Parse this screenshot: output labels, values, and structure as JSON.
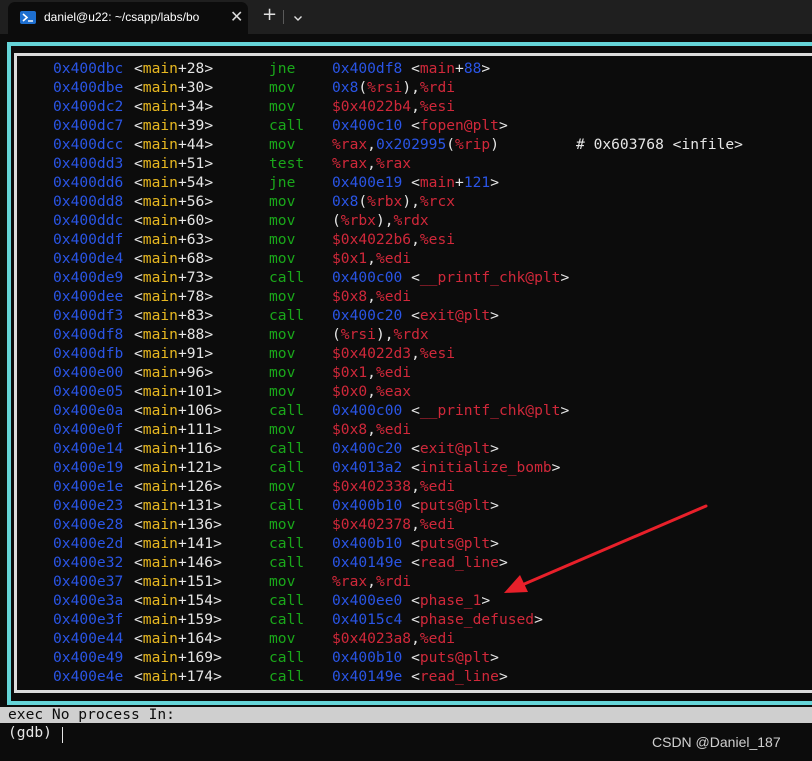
{
  "window": {
    "tab_title": "daniel@u22: ~/csapp/labs/bo",
    "close_glyph": "✕",
    "new_tab_glyph": "+"
  },
  "disassembly": [
    {
      "addr": "0x400dbc",
      "fn": "main",
      "off": "+28",
      "mnemonic": "jne",
      "operands": [
        {
          "t": "0x400df8 ",
          "c": "num"
        },
        {
          "t": "<",
          "c": "w"
        },
        {
          "t": "main",
          "c": "sym"
        },
        {
          "t": "+",
          "c": "w"
        },
        {
          "t": "88",
          "c": "num"
        },
        {
          "t": ">",
          "c": "w"
        }
      ]
    },
    {
      "addr": "0x400dbe",
      "fn": "main",
      "off": "+30",
      "mnemonic": "mov",
      "operands": [
        {
          "t": "0x8",
          "c": "num"
        },
        {
          "t": "(",
          "c": "w"
        },
        {
          "t": "%rsi",
          "c": "reg"
        },
        {
          "t": "),",
          "c": "w"
        },
        {
          "t": "%rdi",
          "c": "reg"
        }
      ]
    },
    {
      "addr": "0x400dc2",
      "fn": "main",
      "off": "+34",
      "mnemonic": "mov",
      "operands": [
        {
          "t": "$0x4022b4",
          "c": "reg"
        },
        {
          "t": ",",
          "c": "w"
        },
        {
          "t": "%esi",
          "c": "reg"
        }
      ]
    },
    {
      "addr": "0x400dc7",
      "fn": "main",
      "off": "+39",
      "mnemonic": "call",
      "operands": [
        {
          "t": "0x400c10 ",
          "c": "num"
        },
        {
          "t": "<",
          "c": "w"
        },
        {
          "t": "fopen@plt",
          "c": "sym"
        },
        {
          "t": ">",
          "c": "w"
        }
      ]
    },
    {
      "addr": "0x400dcc",
      "fn": "main",
      "off": "+44",
      "mnemonic": "mov",
      "operands": [
        {
          "t": "%rax",
          "c": "reg"
        },
        {
          "t": ",",
          "c": "w"
        },
        {
          "t": "0x202995",
          "c": "num"
        },
        {
          "t": "(",
          "c": "w"
        },
        {
          "t": "%rip",
          "c": "reg"
        },
        {
          "t": ")",
          "c": "w"
        }
      ],
      "comment": "# 0x603768 <infile>"
    },
    {
      "addr": "0x400dd3",
      "fn": "main",
      "off": "+51",
      "mnemonic": "test",
      "operands": [
        {
          "t": "%rax",
          "c": "reg"
        },
        {
          "t": ",",
          "c": "w"
        },
        {
          "t": "%rax",
          "c": "reg"
        }
      ]
    },
    {
      "addr": "0x400dd6",
      "fn": "main",
      "off": "+54",
      "mnemonic": "jne",
      "operands": [
        {
          "t": "0x400e19 ",
          "c": "num"
        },
        {
          "t": "<",
          "c": "w"
        },
        {
          "t": "main",
          "c": "sym"
        },
        {
          "t": "+",
          "c": "w"
        },
        {
          "t": "121",
          "c": "num"
        },
        {
          "t": ">",
          "c": "w"
        }
      ]
    },
    {
      "addr": "0x400dd8",
      "fn": "main",
      "off": "+56",
      "mnemonic": "mov",
      "operands": [
        {
          "t": "0x8",
          "c": "num"
        },
        {
          "t": "(",
          "c": "w"
        },
        {
          "t": "%rbx",
          "c": "reg"
        },
        {
          "t": "),",
          "c": "w"
        },
        {
          "t": "%rcx",
          "c": "reg"
        }
      ]
    },
    {
      "addr": "0x400ddc",
      "fn": "main",
      "off": "+60",
      "mnemonic": "mov",
      "operands": [
        {
          "t": "(",
          "c": "w"
        },
        {
          "t": "%rbx",
          "c": "reg"
        },
        {
          "t": "),",
          "c": "w"
        },
        {
          "t": "%rdx",
          "c": "reg"
        }
      ]
    },
    {
      "addr": "0x400ddf",
      "fn": "main",
      "off": "+63",
      "mnemonic": "mov",
      "operands": [
        {
          "t": "$0x4022b6",
          "c": "reg"
        },
        {
          "t": ",",
          "c": "w"
        },
        {
          "t": "%esi",
          "c": "reg"
        }
      ]
    },
    {
      "addr": "0x400de4",
      "fn": "main",
      "off": "+68",
      "mnemonic": "mov",
      "operands": [
        {
          "t": "$0x1",
          "c": "reg"
        },
        {
          "t": ",",
          "c": "w"
        },
        {
          "t": "%edi",
          "c": "reg"
        }
      ]
    },
    {
      "addr": "0x400de9",
      "fn": "main",
      "off": "+73",
      "mnemonic": "call",
      "operands": [
        {
          "t": "0x400c00 ",
          "c": "num"
        },
        {
          "t": "<",
          "c": "w"
        },
        {
          "t": "__printf_chk@plt",
          "c": "sym"
        },
        {
          "t": ">",
          "c": "w"
        }
      ]
    },
    {
      "addr": "0x400dee",
      "fn": "main",
      "off": "+78",
      "mnemonic": "mov",
      "operands": [
        {
          "t": "$0x8",
          "c": "reg"
        },
        {
          "t": ",",
          "c": "w"
        },
        {
          "t": "%edi",
          "c": "reg"
        }
      ]
    },
    {
      "addr": "0x400df3",
      "fn": "main",
      "off": "+83",
      "mnemonic": "call",
      "operands": [
        {
          "t": "0x400c20 ",
          "c": "num"
        },
        {
          "t": "<",
          "c": "w"
        },
        {
          "t": "exit@plt",
          "c": "sym"
        },
        {
          "t": ">",
          "c": "w"
        }
      ]
    },
    {
      "addr": "0x400df8",
      "fn": "main",
      "off": "+88",
      "mnemonic": "mov",
      "operands": [
        {
          "t": "(",
          "c": "w"
        },
        {
          "t": "%rsi",
          "c": "reg"
        },
        {
          "t": "),",
          "c": "w"
        },
        {
          "t": "%rdx",
          "c": "reg"
        }
      ]
    },
    {
      "addr": "0x400dfb",
      "fn": "main",
      "off": "+91",
      "mnemonic": "mov",
      "operands": [
        {
          "t": "$0x4022d3",
          "c": "reg"
        },
        {
          "t": ",",
          "c": "w"
        },
        {
          "t": "%esi",
          "c": "reg"
        }
      ]
    },
    {
      "addr": "0x400e00",
      "fn": "main",
      "off": "+96",
      "mnemonic": "mov",
      "operands": [
        {
          "t": "$0x1",
          "c": "reg"
        },
        {
          "t": ",",
          "c": "w"
        },
        {
          "t": "%edi",
          "c": "reg"
        }
      ]
    },
    {
      "addr": "0x400e05",
      "fn": "main",
      "off": "+101",
      "mnemonic": "mov",
      "operands": [
        {
          "t": "$0x0",
          "c": "reg"
        },
        {
          "t": ",",
          "c": "w"
        },
        {
          "t": "%eax",
          "c": "reg"
        }
      ]
    },
    {
      "addr": "0x400e0a",
      "fn": "main",
      "off": "+106",
      "mnemonic": "call",
      "operands": [
        {
          "t": "0x400c00 ",
          "c": "num"
        },
        {
          "t": "<",
          "c": "w"
        },
        {
          "t": "__printf_chk@plt",
          "c": "sym"
        },
        {
          "t": ">",
          "c": "w"
        }
      ]
    },
    {
      "addr": "0x400e0f",
      "fn": "main",
      "off": "+111",
      "mnemonic": "mov",
      "operands": [
        {
          "t": "$0x8",
          "c": "reg"
        },
        {
          "t": ",",
          "c": "w"
        },
        {
          "t": "%edi",
          "c": "reg"
        }
      ]
    },
    {
      "addr": "0x400e14",
      "fn": "main",
      "off": "+116",
      "mnemonic": "call",
      "operands": [
        {
          "t": "0x400c20 ",
          "c": "num"
        },
        {
          "t": "<",
          "c": "w"
        },
        {
          "t": "exit@plt",
          "c": "sym"
        },
        {
          "t": ">",
          "c": "w"
        }
      ]
    },
    {
      "addr": "0x400e19",
      "fn": "main",
      "off": "+121",
      "mnemonic": "call",
      "operands": [
        {
          "t": "0x4013a2 ",
          "c": "num"
        },
        {
          "t": "<",
          "c": "w"
        },
        {
          "t": "initialize_bomb",
          "c": "sym"
        },
        {
          "t": ">",
          "c": "w"
        }
      ]
    },
    {
      "addr": "0x400e1e",
      "fn": "main",
      "off": "+126",
      "mnemonic": "mov",
      "operands": [
        {
          "t": "$0x402338",
          "c": "reg"
        },
        {
          "t": ",",
          "c": "w"
        },
        {
          "t": "%edi",
          "c": "reg"
        }
      ]
    },
    {
      "addr": "0x400e23",
      "fn": "main",
      "off": "+131",
      "mnemonic": "call",
      "operands": [
        {
          "t": "0x400b10 ",
          "c": "num"
        },
        {
          "t": "<",
          "c": "w"
        },
        {
          "t": "puts@plt",
          "c": "sym"
        },
        {
          "t": ">",
          "c": "w"
        }
      ]
    },
    {
      "addr": "0x400e28",
      "fn": "main",
      "off": "+136",
      "mnemonic": "mov",
      "operands": [
        {
          "t": "$0x402378",
          "c": "reg"
        },
        {
          "t": ",",
          "c": "w"
        },
        {
          "t": "%edi",
          "c": "reg"
        }
      ]
    },
    {
      "addr": "0x400e2d",
      "fn": "main",
      "off": "+141",
      "mnemonic": "call",
      "operands": [
        {
          "t": "0x400b10 ",
          "c": "num"
        },
        {
          "t": "<",
          "c": "w"
        },
        {
          "t": "puts@plt",
          "c": "sym"
        },
        {
          "t": ">",
          "c": "w"
        }
      ]
    },
    {
      "addr": "0x400e32",
      "fn": "main",
      "off": "+146",
      "mnemonic": "call",
      "operands": [
        {
          "t": "0x40149e ",
          "c": "num"
        },
        {
          "t": "<",
          "c": "w"
        },
        {
          "t": "read_line",
          "c": "sym"
        },
        {
          "t": ">",
          "c": "w"
        }
      ]
    },
    {
      "addr": "0x400e37",
      "fn": "main",
      "off": "+151",
      "mnemonic": "mov",
      "operands": [
        {
          "t": "%rax",
          "c": "reg"
        },
        {
          "t": ",",
          "c": "w"
        },
        {
          "t": "%rdi",
          "c": "reg"
        }
      ]
    },
    {
      "addr": "0x400e3a",
      "fn": "main",
      "off": "+154",
      "mnemonic": "call",
      "operands": [
        {
          "t": "0x400ee0 ",
          "c": "num"
        },
        {
          "t": "<",
          "c": "w"
        },
        {
          "t": "phase_1",
          "c": "sym"
        },
        {
          "t": ">",
          "c": "w"
        }
      ]
    },
    {
      "addr": "0x400e3f",
      "fn": "main",
      "off": "+159",
      "mnemonic": "call",
      "operands": [
        {
          "t": "0x4015c4 ",
          "c": "num"
        },
        {
          "t": "<",
          "c": "w"
        },
        {
          "t": "phase_defused",
          "c": "sym"
        },
        {
          "t": ">",
          "c": "w"
        }
      ]
    },
    {
      "addr": "0x400e44",
      "fn": "main",
      "off": "+164",
      "mnemonic": "mov",
      "operands": [
        {
          "t": "$0x4023a8",
          "c": "reg"
        },
        {
          "t": ",",
          "c": "w"
        },
        {
          "t": "%edi",
          "c": "reg"
        }
      ]
    },
    {
      "addr": "0x400e49",
      "fn": "main",
      "off": "+169",
      "mnemonic": "call",
      "operands": [
        {
          "t": "0x400b10 ",
          "c": "num"
        },
        {
          "t": "<",
          "c": "w"
        },
        {
          "t": "puts@plt",
          "c": "sym"
        },
        {
          "t": ">",
          "c": "w"
        }
      ]
    },
    {
      "addr": "0x400e4e",
      "fn": "main",
      "off": "+174",
      "mnemonic": "call",
      "operands": [
        {
          "t": "0x40149e ",
          "c": "num"
        },
        {
          "t": "<",
          "c": "w"
        },
        {
          "t": "read_line",
          "c": "sym"
        },
        {
          "t": ">",
          "c": "w"
        }
      ]
    }
  ],
  "status_line": "exec No process In:",
  "prompt": "(gdb) ",
  "watermark": "CSDN @Daniel_187",
  "colors": {
    "address": "#2a55e6",
    "function": "#e8b820",
    "mnemonic": "#1aa81a",
    "register_symbol": "#d0283a",
    "frame": "#65d4d8",
    "arrow": "#e8202a"
  },
  "icons": [
    "powershell-icon",
    "close-icon",
    "plus-icon",
    "chevron-down-icon"
  ]
}
